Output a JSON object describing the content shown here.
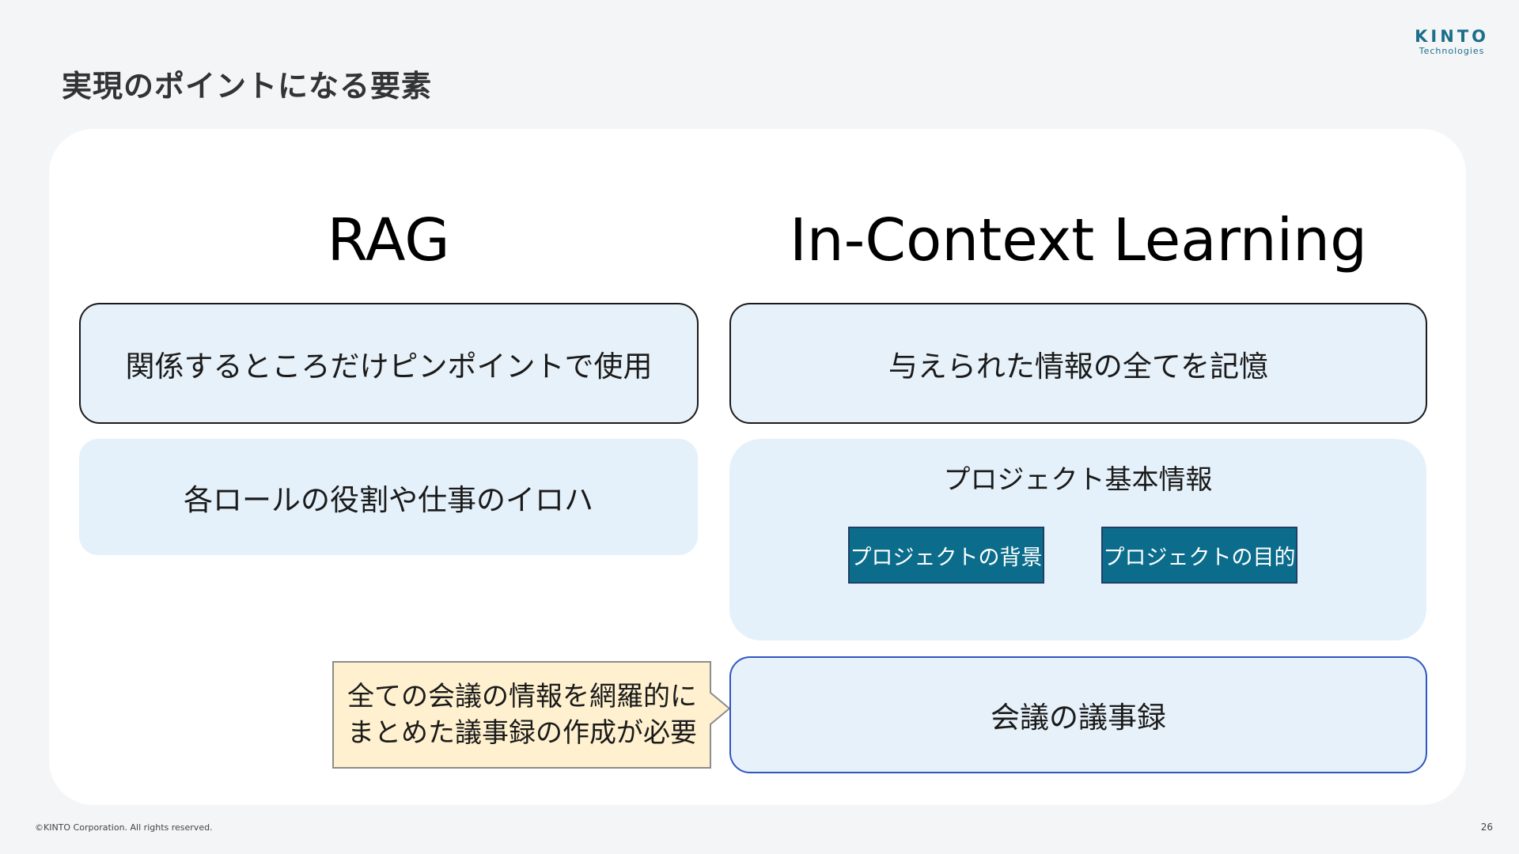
{
  "slide": {
    "title": "実現のポイントになる要素"
  },
  "logo": {
    "main": "KINTO",
    "sub": "Technologies"
  },
  "left_column": {
    "heading": "RAG",
    "primary_box": "関係するところだけピンポイントで使用",
    "item_box": "各ロールの役割や仕事のイロハ"
  },
  "right_column": {
    "heading": "In-Context Learning",
    "primary_box": "与えられた情報の全てを記憶",
    "group": {
      "label": "プロジェクト基本情報",
      "chips": [
        "プロジェクトの背景",
        "プロジェクトの目的"
      ]
    },
    "minutes_box": "会議の議事録"
  },
  "callout": {
    "text": "全ての会議の情報を網羅的に\nまとめた議事録の作成が必要"
  },
  "footer": {
    "copyright": "©KINTO Corporation. All rights reserved.",
    "page_number": "26"
  },
  "colors": {
    "background": "#f3f5f7",
    "panel": "#ffffff",
    "light_blue": "#e5f1fa",
    "chip_teal": "#0b6d8b",
    "callout_fill": "#fff1cf",
    "minutes_border": "#2f56c2",
    "logo": "#1b6f8a"
  }
}
